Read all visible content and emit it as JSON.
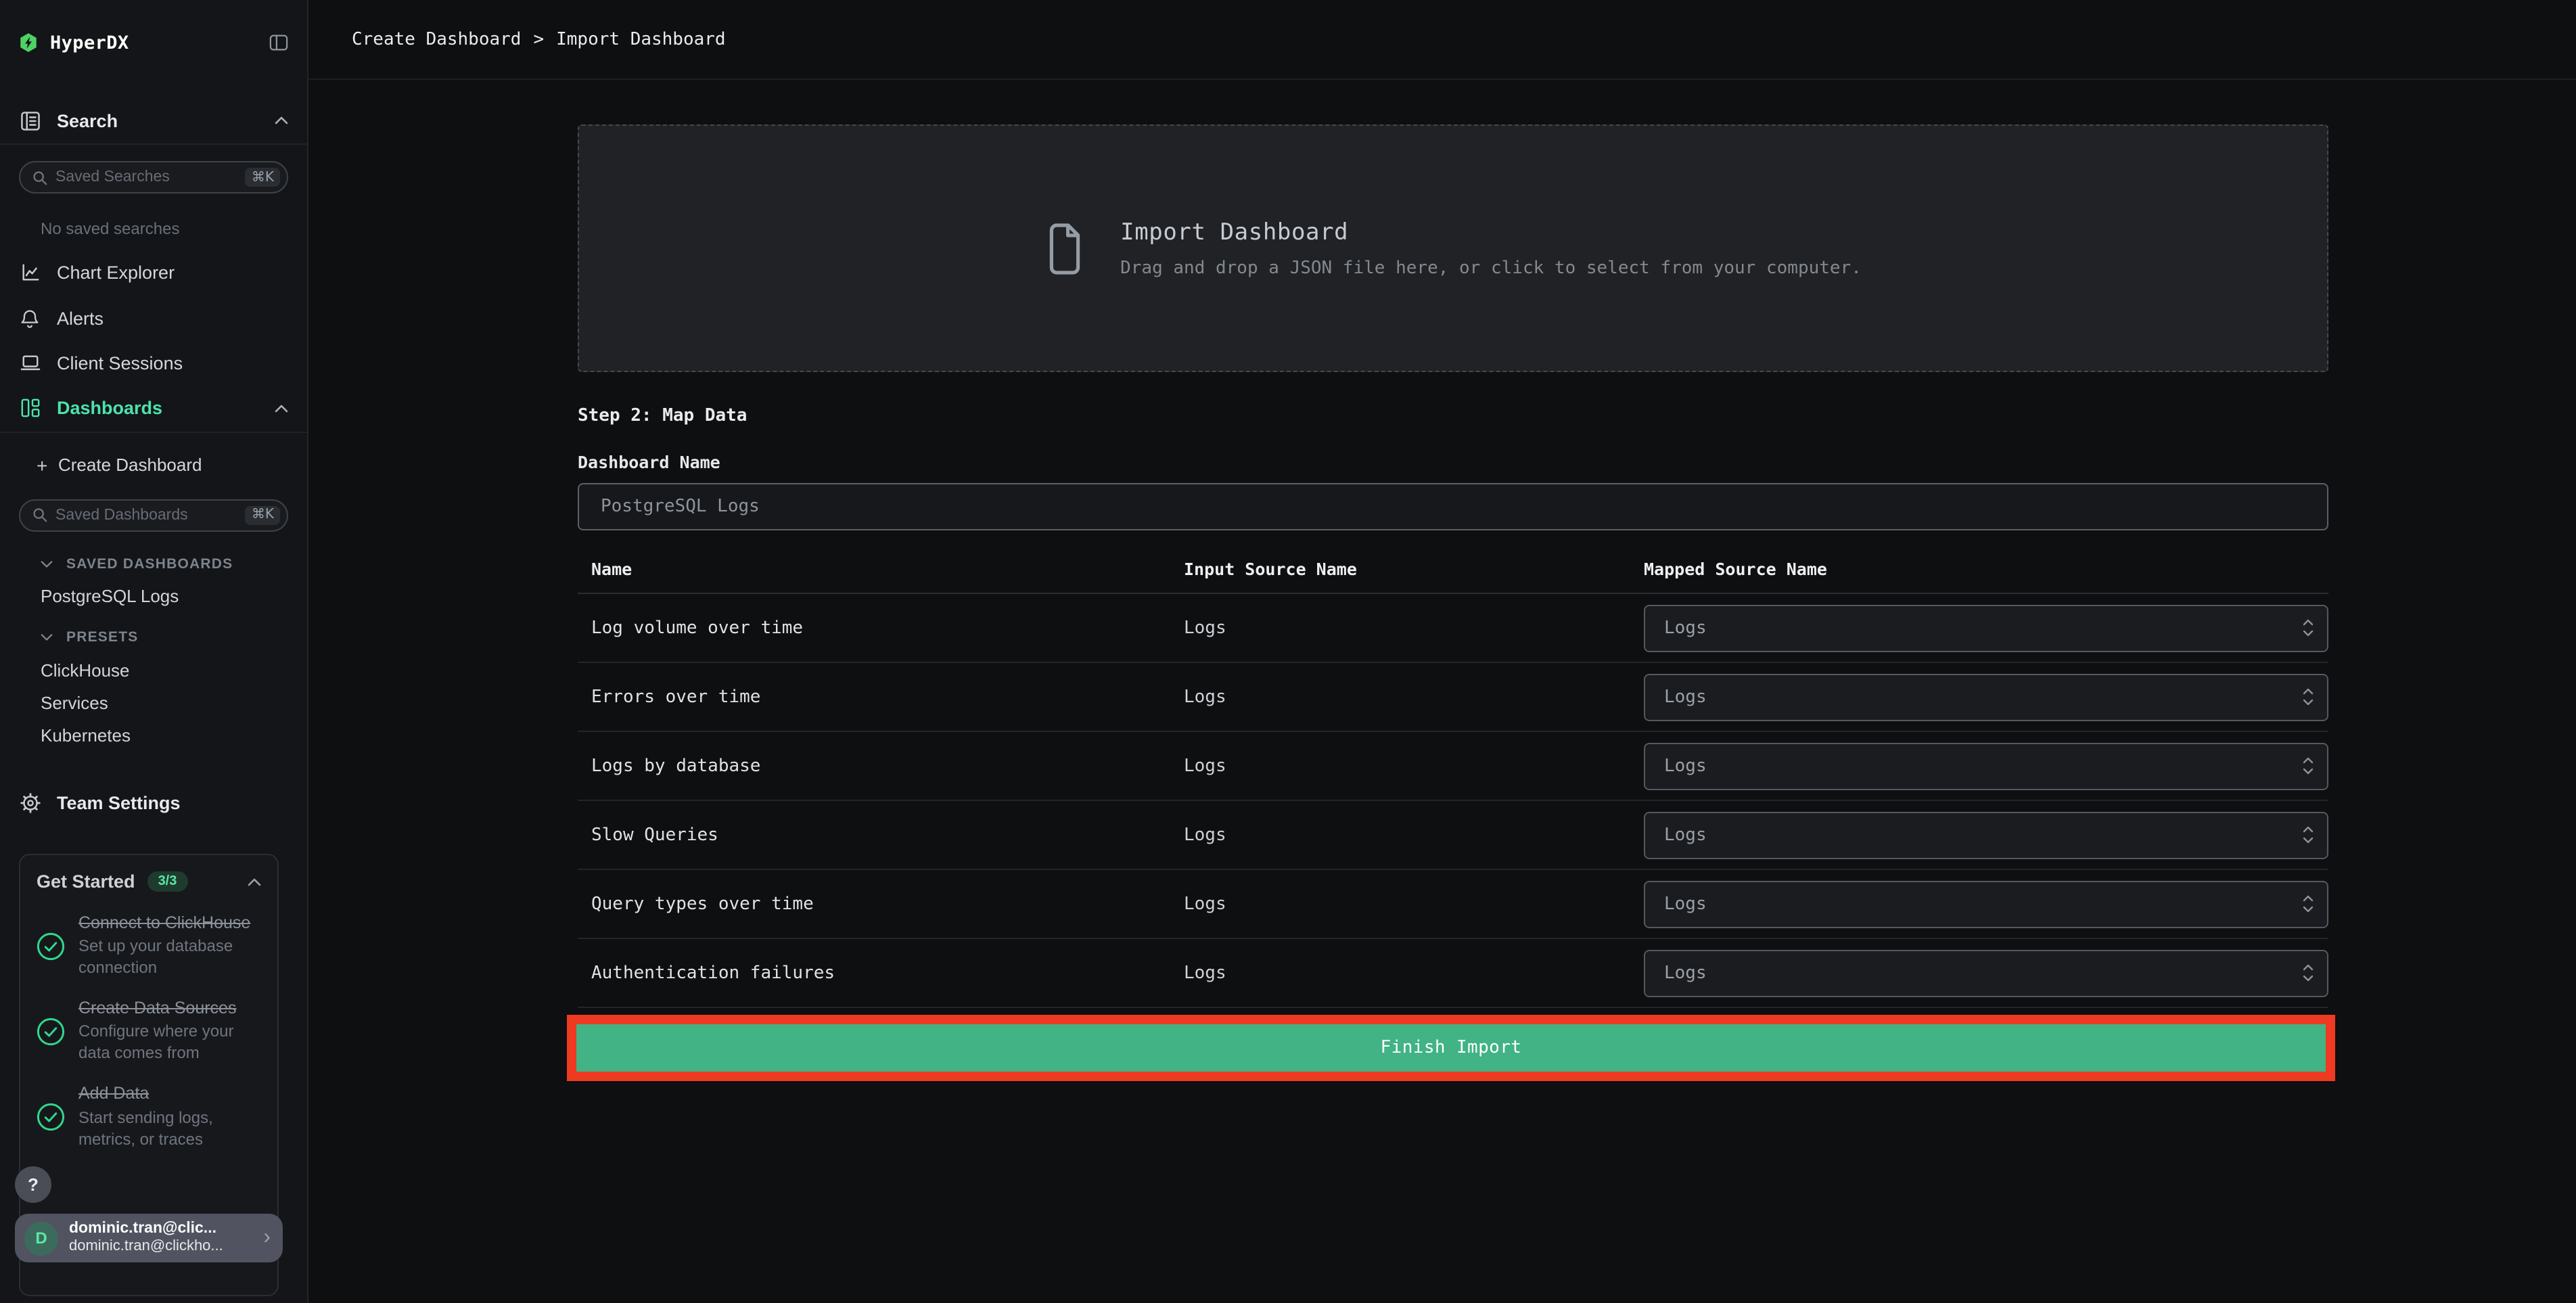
{
  "app": {
    "name": "HyperDX"
  },
  "colors": {
    "accent_green": "#4be3ac",
    "logo_green": "#4cd366",
    "button_green": "#41b384",
    "annotation_red": "#ee3a20",
    "badge_green": "#58e9a9"
  },
  "sidebar": {
    "search_section_label": "Search",
    "saved_searches_input": {
      "placeholder": "Saved Searches",
      "shortcut": "⌘K"
    },
    "no_saved_searches": "No saved searches",
    "nav": [
      {
        "label": "Chart Explorer"
      },
      {
        "label": "Alerts"
      },
      {
        "label": "Client Sessions"
      },
      {
        "label": "Dashboards"
      }
    ],
    "create_dashboard_label": "Create Dashboard",
    "create_dashboard_plus": "+",
    "saved_dashboards_input": {
      "placeholder": "Saved Dashboards",
      "shortcut": "⌘K"
    },
    "saved_dashboards_group": {
      "label": "SAVED DASHBOARDS",
      "items": [
        "PostgreSQL Logs"
      ]
    },
    "presets_group": {
      "label": "PRESETS",
      "items": [
        "ClickHouse",
        "Services",
        "Kubernetes"
      ]
    },
    "team_settings_label": "Team Settings",
    "get_started": {
      "title": "Get Started",
      "badge": "3/3",
      "items": [
        {
          "title": "Connect to ClickHouse",
          "subtitle": "Set up your database connection"
        },
        {
          "title": "Create Data Sources",
          "subtitle": "Configure where your data comes from"
        },
        {
          "title": "Add Data",
          "subtitle": "Start sending logs, metrics, or traces"
        }
      ]
    },
    "help_label": "?",
    "user": {
      "initial": "D",
      "name": "dominic.tran@clic...",
      "email": "dominic.tran@clickho...",
      "chevron": "›"
    }
  },
  "header": {
    "breadcrumb": [
      "Create Dashboard",
      "Import Dashboard"
    ],
    "separator": ">"
  },
  "main": {
    "dropzone": {
      "title": "Import Dashboard",
      "subtitle": "Drag and drop a JSON file here, or click to select from your computer."
    },
    "step_title": "Step 2: Map Data",
    "dashboard_name_label": "Dashboard Name",
    "dashboard_name_value": "PostgreSQL Logs",
    "table": {
      "columns": [
        "Name",
        "Input Source Name",
        "Mapped Source Name"
      ],
      "rows": [
        {
          "name": "Log volume over time",
          "input_source": "Logs",
          "mapped_source": "Logs"
        },
        {
          "name": "Errors over time",
          "input_source": "Logs",
          "mapped_source": "Logs"
        },
        {
          "name": "Logs by database",
          "input_source": "Logs",
          "mapped_source": "Logs"
        },
        {
          "name": "Slow Queries",
          "input_source": "Logs",
          "mapped_source": "Logs"
        },
        {
          "name": "Query types over time",
          "input_source": "Logs",
          "mapped_source": "Logs"
        },
        {
          "name": "Authentication failures",
          "input_source": "Logs",
          "mapped_source": "Logs"
        }
      ]
    },
    "finish_button_label": "Finish Import"
  }
}
